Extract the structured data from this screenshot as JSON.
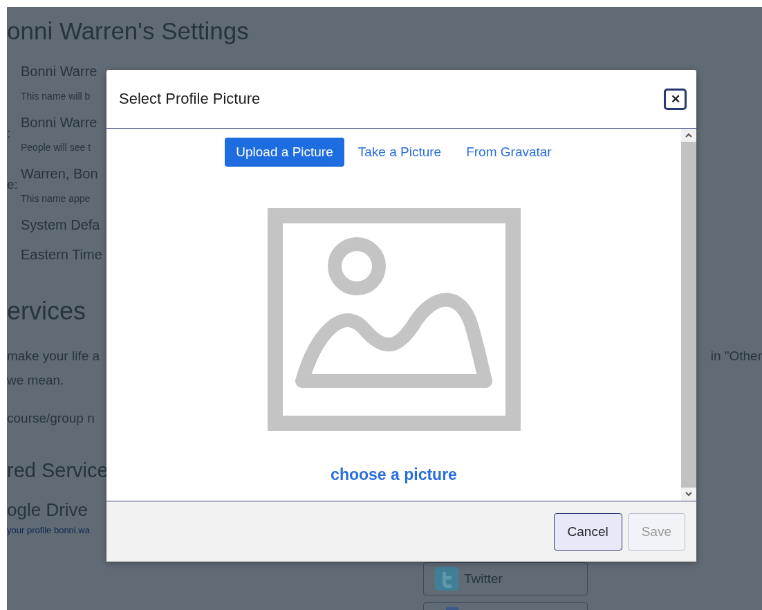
{
  "background_page": {
    "title": "onni Warren's Settings",
    "fields": [
      {
        "value": "Bonni Warre",
        "hint": "This name will b"
      },
      {
        "label": ":",
        "value": "Bonni Warre",
        "hint": "People will see t"
      },
      {
        "label": "e:",
        "value": "Warren, Bon",
        "hint": "This name appe"
      },
      {
        "value": "System Defa"
      },
      {
        "value": "Eastern Time"
      }
    ],
    "services_heading": "ervices",
    "services_text_left": "make your life a",
    "services_text_right": "in \"Other",
    "services_text_line2": "we mean.",
    "services_note": "course/group n",
    "registered_heading": "red Service",
    "service_name": "ogle Drive",
    "profile_link": "your profile bonni.wa",
    "service_buttons": [
      {
        "label": "Twitter",
        "kind": "twitter"
      },
      {
        "kind": "blank"
      }
    ]
  },
  "dialog": {
    "title": "Select Profile Picture",
    "close_label": "✕",
    "tabs": [
      {
        "label": "Upload a Picture",
        "selected": true
      },
      {
        "label": "Take a Picture",
        "selected": false
      },
      {
        "label": "From Gravatar",
        "selected": false
      }
    ],
    "choose_link": "choose a picture",
    "buttons": [
      {
        "label": "Cancel",
        "disabled": false
      },
      {
        "label": "Save",
        "disabled": true
      }
    ]
  }
}
